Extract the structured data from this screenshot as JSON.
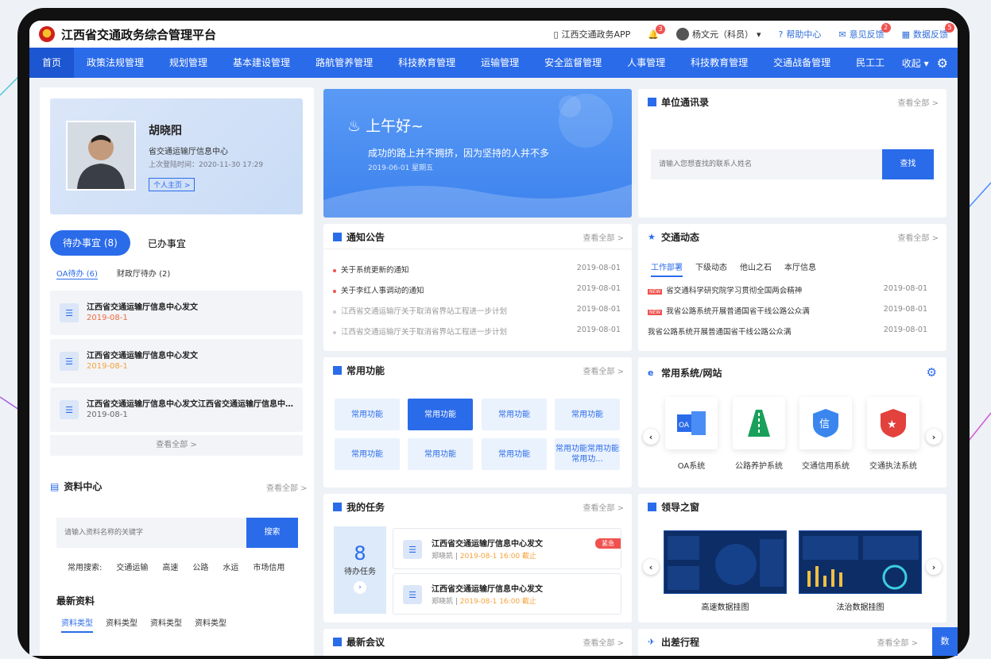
{
  "header": {
    "title": "江西省交通政务综合管理平台",
    "app_link": "江西交通政务APP",
    "notif_count": "3",
    "user": "杨文元（科员）",
    "help": "帮助中心",
    "feedback": "意见反馈",
    "feedback_count": "2",
    "data_feedback": "数据反馈",
    "data_feedback_count": "5"
  },
  "nav": {
    "items": [
      "首页",
      "政策法规管理",
      "规划管理",
      "基本建设管理",
      "路航管养管理",
      "科技教育管理",
      "运输管理",
      "安全监督管理",
      "人事管理",
      "科技教育管理",
      "交通战备管理",
      "民工工"
    ],
    "collapse": "收起"
  },
  "profile": {
    "name": "胡晓阳",
    "org": "省交通运输厅信息中心",
    "last_login": "上次登陆时间：2020-11-30  17:29",
    "home_link": "个人主页 >"
  },
  "todo": {
    "tab_active": "待办事宜 (8)",
    "tab_done": "已办事宜",
    "sub_oa": "OA待办 (6)",
    "sub_fin": "财政厅待办 (2)",
    "items": [
      {
        "title": "江西省交通运输厅信息中心发文",
        "date": "2019-08-1"
      },
      {
        "title": "江西省交通运输厅信息中心发文",
        "date": "2019-08-1"
      },
      {
        "title": "江西省交通运输厅信息中心发文江西省交通运输厅信息中心发文",
        "date": "2019-08-1"
      }
    ],
    "view_all": "查看全部 >"
  },
  "library": {
    "title": "资料中心",
    "more": "查看全部 >",
    "placeholder": "请输入资料名称的关键字",
    "search_btn": "搜索",
    "common_label": "常用搜索:",
    "common": [
      "交通运输",
      "高速",
      "公路",
      "水运",
      "市场信用"
    ],
    "latest": "最新资料",
    "types": [
      "资料类型",
      "资料类型",
      "资料类型",
      "资料类型"
    ]
  },
  "greeting": {
    "hello": "上午好~",
    "motto": "成功的路上并不拥挤，因为坚持的人并不多",
    "date": "2019-06-01  星期五"
  },
  "directory": {
    "title": "单位通讯录",
    "more": "查看全部 >",
    "placeholder": "请输入您想查找的联系人姓名",
    "btn": "查找"
  },
  "notices": {
    "title": "通知公告",
    "more": "查看全部 >",
    "items": [
      {
        "text": "关于系统更新的通知",
        "date": "2019-08-01",
        "unread": true
      },
      {
        "text": "关于李红人事调动的通知",
        "date": "2019-08-01",
        "unread": true
      },
      {
        "text": "江西省交通运输厅关于取消省界站工程进一步计划",
        "date": "2019-08-01",
        "unread": false
      },
      {
        "text": "江西省交通运输厅关于取消省界站工程进一步计划",
        "date": "2019-08-01",
        "unread": false
      }
    ]
  },
  "news": {
    "title": "交通动态",
    "more": "查看全部 >",
    "tabs": [
      "工作部署",
      "下级动态",
      "他山之石",
      "本厅信息"
    ],
    "items": [
      {
        "text": "省交通科学研究院学习贯彻全国两会精神",
        "date": "2019-08-01",
        "new": true
      },
      {
        "text": "我省公路系统开展普通国省干线公路公众满",
        "date": "2019-08-01",
        "new": true
      },
      {
        "text": "我省公路系统开展普通国省干线公路公众满",
        "date": "2019-08-01",
        "new": false
      }
    ],
    "new_tag": "NEW"
  },
  "functions": {
    "title": "常用功能",
    "more": "查看全部 >",
    "items": [
      "常用功能",
      "常用功能",
      "常用功能",
      "常用功能",
      "常用功能",
      "常用功能",
      "常用功能",
      "常用功能常用功能常用功..."
    ]
  },
  "systems": {
    "title": "常用系统/网站",
    "items": [
      "OA系统",
      "公路养护系统",
      "交通信用系统",
      "交通执法系统"
    ]
  },
  "tasks": {
    "title": "我的任务",
    "more": "查看全部 >",
    "count": "8",
    "count_label": "待办任务",
    "items": [
      {
        "title": "江西省交通运输厅信息中心发文",
        "who": "郑晓凯 | ",
        "time": "2019-08-1 16:00 截止",
        "tag": "紧急"
      },
      {
        "title": "江西省交通运输厅信息中心发文",
        "who": "郑晓凯 | ",
        "time": "2019-08-1 16:00 截止",
        "tag": ""
      }
    ]
  },
  "leaders": {
    "title": "领导之窗",
    "items": [
      "高速数据挂图",
      "法治数据挂图"
    ]
  },
  "bottom": {
    "meeting": "最新会议",
    "meeting_more": "查看全部 >",
    "trip": "出差行程",
    "trip_more": "查看全部 >",
    "side_tab": "数"
  }
}
